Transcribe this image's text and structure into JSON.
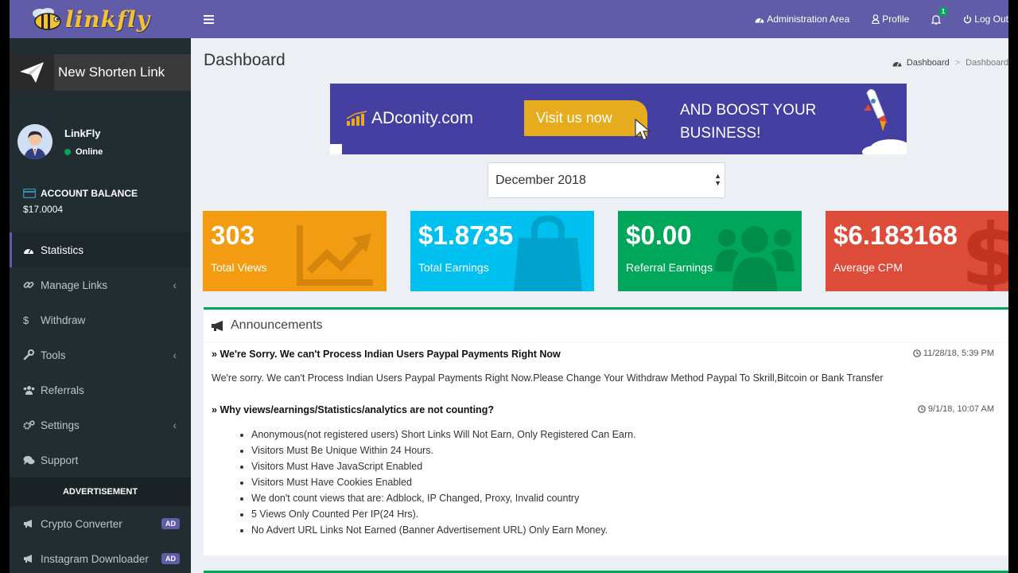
{
  "app": {
    "logo_text": "linkfly"
  },
  "sidebar": {
    "new_link_label": "New Shorten Link",
    "user": {
      "name": "LinkFly",
      "status": "Online"
    },
    "balance": {
      "label": "ACCOUNT BALANCE",
      "value": "$17.0004"
    },
    "menu": [
      {
        "label": "Statistics",
        "icon": "dashboard-icon",
        "active": true
      },
      {
        "label": "Manage Links",
        "icon": "link-icon",
        "has_children": true
      },
      {
        "label": "Withdraw",
        "icon": "dollar-icon"
      },
      {
        "label": "Tools",
        "icon": "wrench-icon",
        "has_children": true
      },
      {
        "label": "Referrals",
        "icon": "users-icon"
      },
      {
        "label": "Settings",
        "icon": "cogs-icon",
        "has_children": true
      },
      {
        "label": "Support",
        "icon": "comments-icon"
      }
    ],
    "ads_header": "ADVERTISEMENT",
    "ads": [
      {
        "label": "Crypto Converter",
        "badge": "AD"
      },
      {
        "label": "Instagram Downloader",
        "badge": "AD"
      }
    ]
  },
  "topnav": {
    "admin_label": "Administration Area",
    "profile_label": "Profile",
    "notifications_count": "1",
    "logout_label": "Log Out"
  },
  "page": {
    "title": "Dashboard",
    "breadcrumb": [
      "Dashboard",
      "Dashboard"
    ]
  },
  "banner": {
    "brand": "ADconity.com",
    "button": "Visit us now",
    "cta_line1": "AND BOOST YOUR",
    "cta_line2": "BUSINESS!"
  },
  "month_select": {
    "value": "December 2018"
  },
  "stats": [
    {
      "value": "303",
      "label": "Total Views",
      "color": "#f39c12",
      "icon": "line-chart-icon"
    },
    {
      "value": "$1.8735",
      "label": "Total Earnings",
      "color": "#00c0ef",
      "icon": "shopping-bag-icon"
    },
    {
      "value": "$0.00",
      "label": "Referral Earnings",
      "color": "#00a65a",
      "icon": "users-icon"
    },
    {
      "value": "$6.183168",
      "label": "Average CPM",
      "color": "#dd4b39",
      "icon": "dollar-icon"
    }
  ],
  "announcements": {
    "title": "Announcements",
    "items": [
      {
        "title": "We're Sorry. We can't Process Indian Users Paypal Payments Right Now",
        "time": "11/28/18, 5:39 PM",
        "body": "We're sorry. We can't Process Indian Users Paypal  Payments Right Now.Please Change Your Withdraw Method Paypal To Skrill,Bitcoin or Bank Transfer"
      },
      {
        "title": "Why views/earnings/Statistics/analytics are not counting?",
        "time": "9/1/18, 10:07 AM",
        "list": [
          "Anonymous(not registered users) Short Links Will Not Earn, Only Registered Can Earn.",
          "Visitors Must Be Unique Within 24 Hours.",
          "Visitors Must Have JavaScript Enabled",
          "Visitors Must Have Cookies Enabled",
          "We don't count views that are: Adblock, IP Changed, Proxy, Invalid country",
          "5 Views Only Counted Per IP(24 Hrs).",
          "No Advert URL Links Not Earned (Banner Advertisement URL) Only Earn Money."
        ]
      }
    ]
  }
}
